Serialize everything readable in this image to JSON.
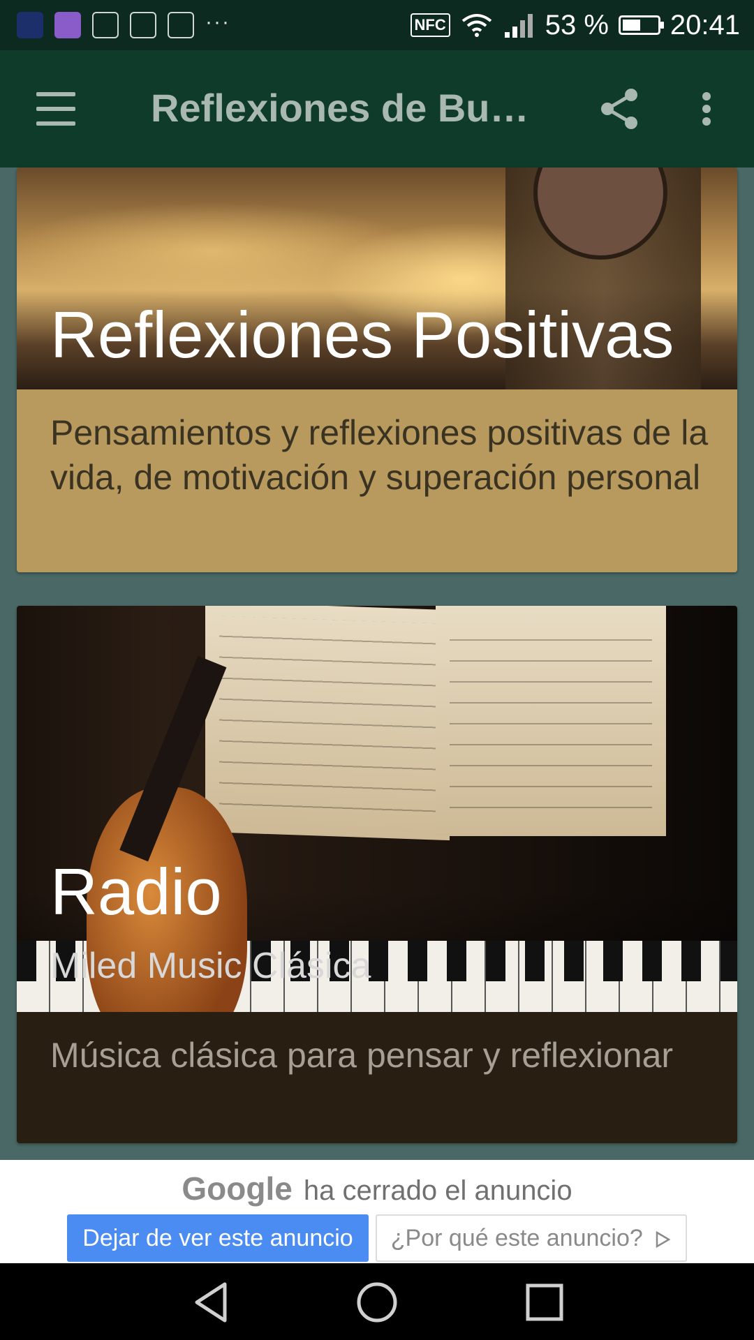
{
  "status_bar": {
    "battery": "53 %",
    "battery_level": 0.53,
    "time": "20:41",
    "nfc": "NFC",
    "overflow": "···"
  },
  "app_bar": {
    "title": "Reflexiones de Bue...",
    "icons": [
      "menu-icon",
      "share-icon",
      "more-vert-icon"
    ]
  },
  "cards": [
    {
      "title": "Reflexiones Positivas",
      "description": "Pensamientos y reflexiones positivas de la vida, de motivación y superación personal"
    },
    {
      "title": "Radio",
      "subtitle": "Miled Music Clásica",
      "description": "Música clásica para pensar y reflexionar"
    }
  ],
  "ad": {
    "brand": "Google",
    "message": "ha cerrado el anuncio",
    "stop_button": "Dejar de ver este anuncio",
    "why_button": "¿Por qué este anuncio?"
  },
  "colors": {
    "app_bar": "#0f3b2b",
    "status_bar": "#0d2a20",
    "card1_desc_bg": "#b89a5e",
    "card2_desc_bg": "#281e12",
    "ad_primary": "#4b8cf3"
  }
}
